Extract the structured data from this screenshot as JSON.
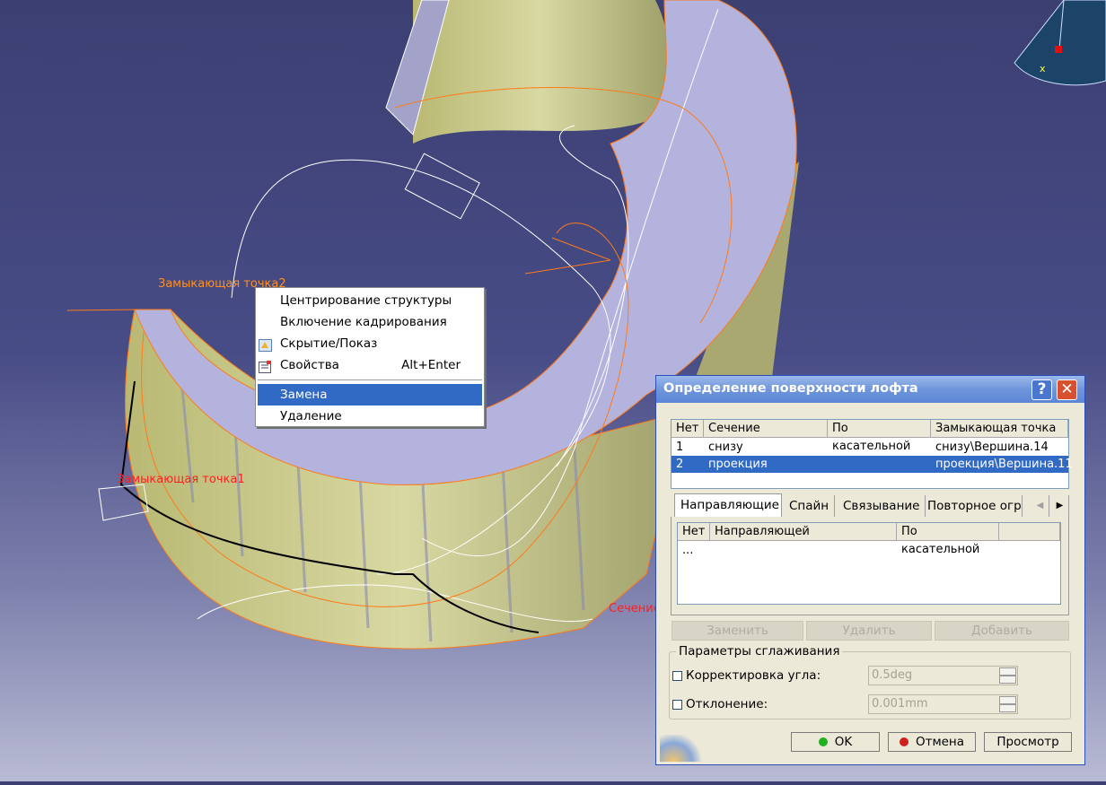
{
  "viewport": {
    "labels": {
      "closing_point_2": "Замыкающая точка2",
      "closing_point_1": "Замыкающая точка1",
      "section": "Сечение",
      "compass_x": "x"
    },
    "colors": {
      "background": "#3b3f72",
      "surface": "#c9c98a",
      "top_face": "#b1b1dc",
      "curve": "#ff7a1a",
      "label_red": "#ff2020",
      "label_orange": "#ff9020"
    }
  },
  "context_menu": {
    "items": [
      {
        "label": "Центрирование структуры",
        "icon": ""
      },
      {
        "label": "Включение кадрирования",
        "icon": ""
      },
      {
        "label": "Скрытие/Показ",
        "icon": "hide-show-icon"
      },
      {
        "label": "Свойства",
        "icon": "properties-icon",
        "shortcut": "Alt+Enter"
      },
      {
        "label": "Замена",
        "icon": "",
        "highlighted": true
      },
      {
        "label": "Удаление",
        "icon": ""
      }
    ]
  },
  "dialog": {
    "title": "Определение поверхности лофта",
    "help_label": "?",
    "close_label": "✕",
    "sections_table": {
      "columns": [
        "Нет",
        "Сечение",
        "По касательной",
        "Замыкающая точка"
      ],
      "rows": [
        {
          "no": "1",
          "section": "снизу",
          "tangent": "",
          "closing_point": "снизу\\Вершина.14",
          "selected": false
        },
        {
          "no": "2",
          "section": "проекция",
          "tangent": "",
          "closing_point": "проекция\\Вершина.11",
          "selected": true
        }
      ]
    },
    "tabs": [
      "Направляющие",
      "Спайн",
      "Связывание",
      "Повторное огра"
    ],
    "guides_table": {
      "columns": [
        "Нет",
        "Направляющей",
        "По касательной"
      ],
      "rows": [
        {
          "no": "...",
          "guide": "",
          "tangent": ""
        }
      ]
    },
    "buttons": {
      "replace": "Заменить",
      "remove": "Удалить",
      "add": "Добавить"
    },
    "smoothing": {
      "legend": "Параметры сглаживания",
      "angle_label": "Корректировка угла:",
      "angle_value": "0.5deg",
      "deviation_label": "Отклонение:",
      "deviation_value": "0.001mm"
    },
    "footer": {
      "ok": "OK",
      "cancel": "Отмена",
      "preview": "Просмотр"
    }
  }
}
